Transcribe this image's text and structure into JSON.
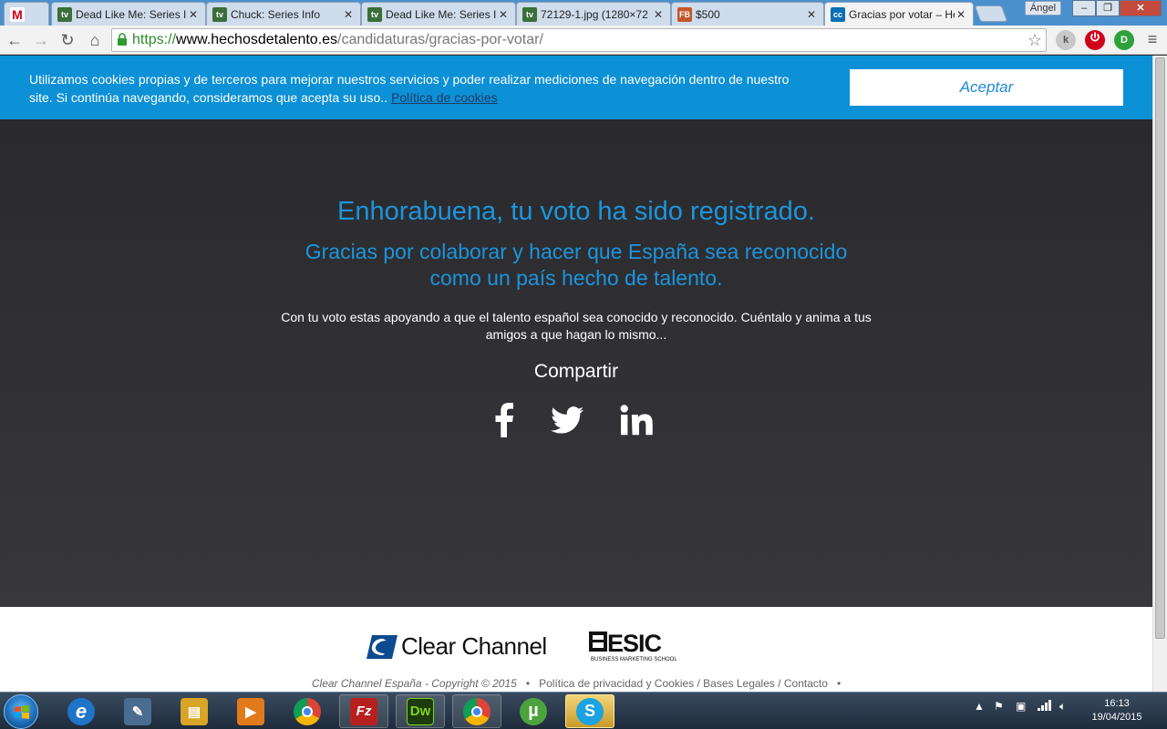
{
  "browser": {
    "tabs": [
      {
        "title": "",
        "favicon": "M",
        "favicon_color": "#d0021b",
        "active": false
      },
      {
        "title": "Dead Like Me: Series I",
        "favicon": "tv",
        "favicon_color": "#3a6e3a",
        "active": false
      },
      {
        "title": "Chuck: Series Info",
        "favicon": "tv",
        "favicon_color": "#3a6e3a",
        "active": false
      },
      {
        "title": "Dead Like Me: Series I",
        "favicon": "tv",
        "favicon_color": "#3a6e3a",
        "active": false
      },
      {
        "title": "72129-1.jpg (1280×72",
        "favicon": "tv",
        "favicon_color": "#3a6e3a",
        "active": false
      },
      {
        "title": "$500",
        "favicon": "FB",
        "favicon_color": "#c4572a",
        "active": false
      },
      {
        "title": "Gracias por votar – He",
        "favicon": "cc",
        "favicon_color": "#0c6fb5",
        "active": true
      }
    ],
    "tab_close_glyph": "✕",
    "user_name": "Ángel",
    "url": {
      "scheme": "https://",
      "host": "www.hechosdetalento.es",
      "path": "/candidaturas/gracias-por-votar/"
    }
  },
  "cookie_banner": {
    "text": "Utilizamos cookies propias y de terceros para mejorar nuestros servicios y poder realizar mediciones de navegación dentro de nuestro site. Si continúa navegando, consideramos que acepta su uso..",
    "link_label": "Política de cookies",
    "accept_label": "Aceptar"
  },
  "main": {
    "headline": "Enhorabuena, tu voto ha sido registrado.",
    "subhead": "Gracias por colaborar y hacer que España sea reconocido como un país hecho de talento.",
    "body": "Con tu voto estas apoyando a que el talento español sea conocido y reconocido. Cuéntalo y anima a tus amigos a que hagan lo mismo...",
    "share_title": "Compartir",
    "social": [
      "facebook-icon",
      "twitter-icon",
      "linkedin-icon"
    ]
  },
  "footer": {
    "clear_channel_label": "Clear Channel",
    "esic_label": "ESIC",
    "esic_sub": "BUSINESS MARKETING SCHOOL",
    "copyright": "Clear Channel España - Copyright © 2015",
    "separator": "•",
    "links": "Política de privacidad y Cookies / Bases Legales / Contacto"
  },
  "taskbar": {
    "apps": [
      {
        "name": "internet-explorer",
        "glyph": "e",
        "color": "#1e74c8"
      },
      {
        "name": "dreamweaver-pencil",
        "glyph": "✎",
        "color": "#4a6c90"
      },
      {
        "name": "file-explorer",
        "glyph": "▤",
        "color": "#d9a526"
      },
      {
        "name": "media-player",
        "glyph": "▶",
        "color": "#e07a1a"
      },
      {
        "name": "chrome",
        "glyph": "◉",
        "color": "#d93a2b"
      },
      {
        "name": "filezilla",
        "glyph": "Fz",
        "color": "#b8201f"
      },
      {
        "name": "dreamweaver",
        "glyph": "Dw",
        "color": "#1d3b0c"
      },
      {
        "name": "chrome-open",
        "glyph": "◉",
        "color": "#2f8f3b"
      },
      {
        "name": "utorrent",
        "glyph": "µ",
        "color": "#4ca33b"
      },
      {
        "name": "skype",
        "glyph": "S",
        "color": "#1aa3e0"
      }
    ],
    "time": "16:13",
    "date": "19/04/2015"
  },
  "colors": {
    "accent_blue": "#1b95dd",
    "banner_blue": "#0c90d6",
    "dark_bg": "#2a292c"
  }
}
